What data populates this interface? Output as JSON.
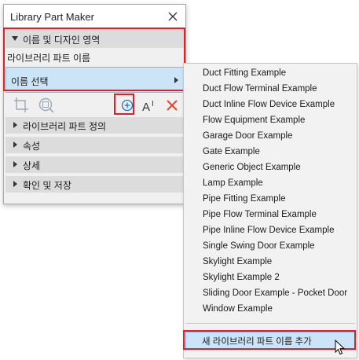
{
  "window": {
    "title": "Library Part Maker"
  },
  "name_section": {
    "header": "이름 및 디자인 영역",
    "library_part_name_label": "라이브러리 파트 이름",
    "select_name": "이름 선택"
  },
  "sections": [
    {
      "label": "라이브러리 파트 정의"
    },
    {
      "label": "속성"
    },
    {
      "label": "상세"
    },
    {
      "label": "확인 및 저장"
    }
  ],
  "menu": {
    "items": [
      "Duct Fitting Example",
      "Duct Flow Terminal Example",
      "Duct Inline Flow Device Example",
      "Flow Equipment Example",
      "Garage Door Example",
      "Gate Example",
      "Generic Object Example",
      "Lamp Example",
      "Pipe Fitting Example",
      "Pipe Flow Terminal Example",
      "Pipe Inline Flow Device Example",
      "Single Swing Door Example",
      "Skylight Example",
      "Skylight Example 2",
      "Sliding Door Example - Pocket Door",
      "Window Example"
    ],
    "add_new": "새 라이브러리 파트 이름 추가"
  },
  "colors": {
    "highlight": "#e21e26",
    "selection": "#cce4f7",
    "add_icon": "#1a73c8",
    "delete_icon": "#e8442d"
  }
}
